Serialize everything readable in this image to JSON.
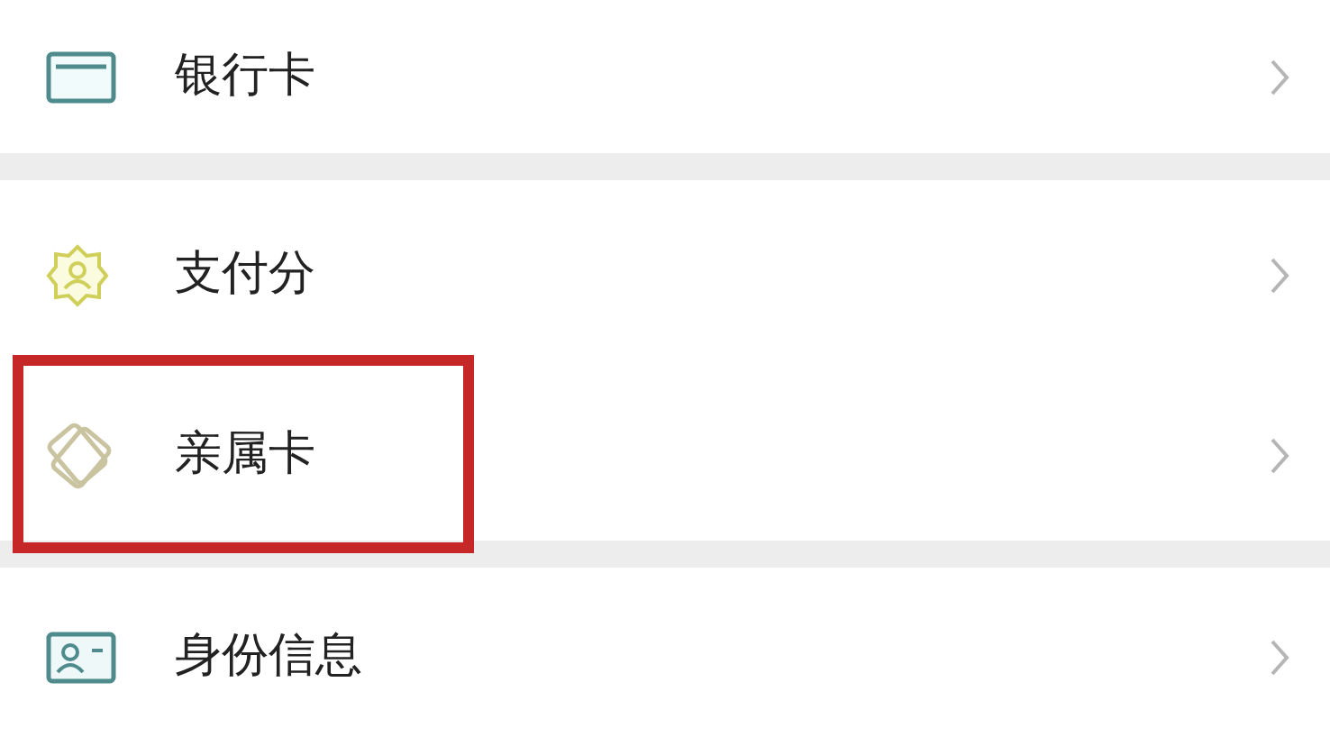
{
  "groups": [
    {
      "items": [
        {
          "kind": "card",
          "label": "银行卡",
          "highlighted": false
        }
      ]
    },
    {
      "items": [
        {
          "kind": "score",
          "label": "支付分",
          "highlighted": false
        },
        {
          "kind": "family",
          "label": "亲属卡",
          "highlighted": true
        }
      ]
    },
    {
      "items": [
        {
          "kind": "id",
          "label": "身份信息",
          "highlighted": false
        }
      ]
    }
  ]
}
